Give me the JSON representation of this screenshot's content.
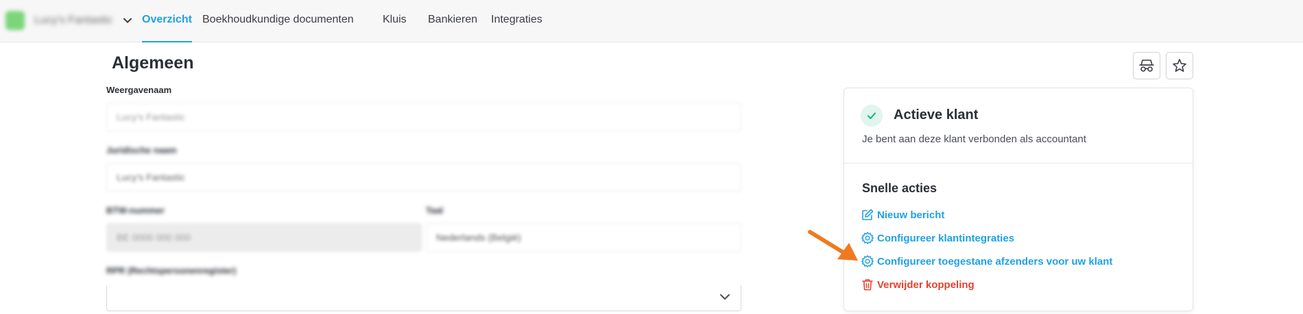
{
  "topbar": {
    "client_name": "Lucy's Fantastic",
    "tabs": [
      {
        "label": "Overzicht",
        "active": true
      },
      {
        "label": "Boekhoudkundige documenten"
      },
      {
        "label": "Kluis"
      },
      {
        "label": "Bankieren"
      },
      {
        "label": "Integraties"
      }
    ]
  },
  "main": {
    "title": "Algemeen",
    "fields": {
      "display_name": {
        "label": "Weergavenaam",
        "value": "Lucy's Fantastic"
      },
      "legal_name": {
        "label": "Juridische naam",
        "value": "Lucy's Fantastic"
      },
      "vat": {
        "label": "BTW-nummer",
        "value": "BE 0000 000 000"
      },
      "language": {
        "label": "Taal",
        "value": "Nederlands (België)"
      },
      "rpr": {
        "label": "RPR (Rechtspersonenregister)",
        "value": ""
      }
    }
  },
  "header_buttons": {
    "incognito_icon": "incognito-icon",
    "favorite_icon": "star-icon"
  },
  "card": {
    "status_title": "Actieve klant",
    "status_desc": "Je bent aan deze klant verbonden als accountant",
    "quick_actions_title": "Snelle acties",
    "actions": [
      {
        "label": "Nieuw bericht",
        "icon": "edit-icon"
      },
      {
        "label": "Configureer klantintegraties",
        "icon": "gear-icon"
      },
      {
        "label": "Configureer toegestane afzenders voor uw klant",
        "icon": "gear-icon"
      },
      {
        "label": "Verwijder koppeling",
        "icon": "trash-icon"
      }
    ]
  },
  "colors": {
    "accent": "#1fa1e6",
    "danger": "#e5412f",
    "success": "#1aae82",
    "annotation_arrow": "#f07a1f"
  }
}
